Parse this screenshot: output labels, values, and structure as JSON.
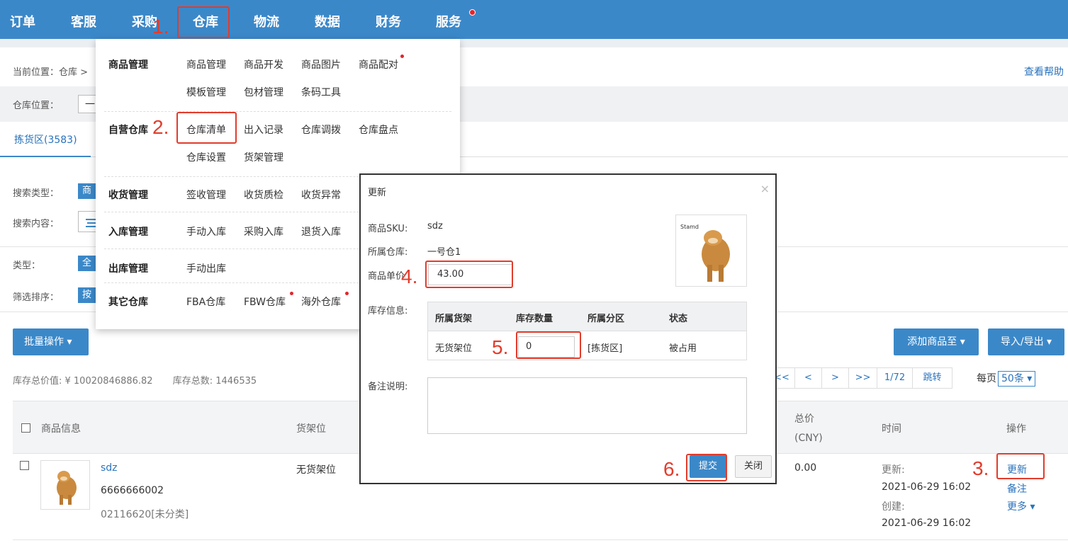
{
  "nav": {
    "items": [
      "订单",
      "客服",
      "采购",
      "仓库",
      "物流",
      "数据",
      "财务",
      "服务"
    ]
  },
  "breadcrumb": "当前位置：仓库 >",
  "help_link": "查看帮助",
  "filter": {
    "warehouse_label": "仓库位置：",
    "warehouse_value": "一"
  },
  "tabs": {
    "active": "拣货区(3583)"
  },
  "search": {
    "type_label": "搜索类型：",
    "type_chip": "商品",
    "content_label": "搜索内容：",
    "category_label": "类型：",
    "category_chip": "全部",
    "sort_label": "筛选排序：",
    "sort_chip": "按"
  },
  "toolbar": {
    "batch_label": "批量操作 ▾",
    "add_label": "添加商品至 ▾",
    "io_label": "导入/导出 ▾"
  },
  "totals": {
    "value": "库存总价值: ¥ 10020846886.82",
    "count": "库存总数: 1446535"
  },
  "pager": {
    "first": "<<",
    "prev": "<",
    "next": ">",
    "last": ">>",
    "page": "1/72",
    "jump": "跳转",
    "per_page_label": "每页",
    "per_page_value": "50条 ▾"
  },
  "table": {
    "headers": {
      "product": "商品信息",
      "shelf": "货架位",
      "total": "总价",
      "currency": "(CNY)",
      "time": "时间",
      "action": "操作"
    },
    "rows": [
      {
        "sku": "sdz",
        "code": "6666666002",
        "category": "02116620[未分类]",
        "shelf": "无货架位",
        "total": "0.00",
        "updated_label": "更新:",
        "updated": "2021-06-29 16:02",
        "created_label": "创建:",
        "created": "2021-06-29 16:02",
        "actions": [
          "更新",
          "备注",
          "更多 ▾"
        ]
      }
    ]
  },
  "dropdown": {
    "groups": [
      {
        "title": "商品管理",
        "items": [
          "商品管理",
          "商品开发",
          "商品图片",
          "商品配对",
          "模板管理",
          "包材管理",
          "条码工具"
        ]
      },
      {
        "title": "自营仓库",
        "items": [
          "仓库清单",
          "出入记录",
          "仓库调拨",
          "仓库盘点",
          "仓库设置",
          "货架管理"
        ]
      },
      {
        "title": "收货管理",
        "items": [
          "签收管理",
          "收货质检",
          "收货异常"
        ]
      },
      {
        "title": "入库管理",
        "items": [
          "手动入库",
          "采购入库",
          "退货入库"
        ]
      },
      {
        "title": "出库管理",
        "items": [
          "手动出库"
        ]
      },
      {
        "title": "其它仓库",
        "items": [
          "FBA仓库",
          "FBW仓库",
          "海外仓库"
        ]
      }
    ]
  },
  "modal": {
    "title": "更新",
    "close_icon": "×",
    "sku_label": "商品SKU:",
    "sku_value": "sdz",
    "warehouse_label": "所属仓库:",
    "warehouse_value": "一号仓1",
    "price_label": "商品单价",
    "price_value": "43.00",
    "stock_label": "库存信息:",
    "stock_headers": [
      "所属货架",
      "库存数量",
      "所属分区",
      "状态"
    ],
    "stock_row": {
      "shelf": "无货架位",
      "qty": "0",
      "zone": "[拣货区]",
      "status": "被占用"
    },
    "note_label": "备注说明:",
    "submit_label": "提交",
    "close_label": "关闭",
    "image_caption": "Stamd"
  },
  "annotations": [
    "1.",
    "2.",
    "3.",
    "4.",
    "5.",
    "6."
  ],
  "colors": {
    "nav_bg": "#3b88c9",
    "link": "#2a73bd",
    "annotation": "#e23c2c"
  }
}
